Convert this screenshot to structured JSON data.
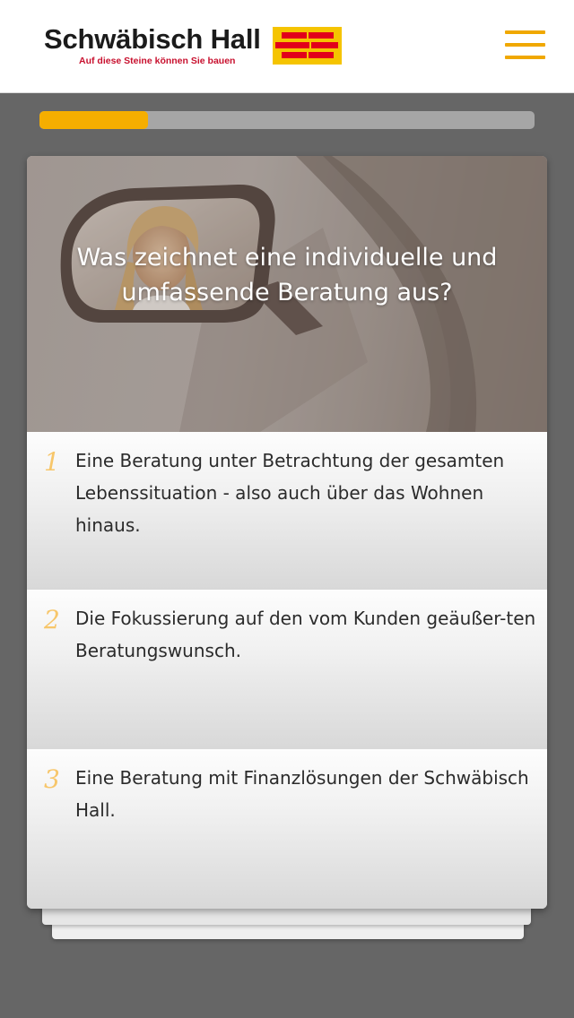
{
  "header": {
    "logo_name": "Schwäbisch Hall",
    "logo_tagline": "Auf diese Steine können Sie bauen",
    "logo_icon": "brick-logo-icon",
    "menu_icon": "hamburger-menu-icon",
    "brand_yellow": "#f5ae00",
    "brand_red": "#c8102e"
  },
  "progress": {
    "fraction": 0.22
  },
  "quiz": {
    "question": "Was zeichnet eine individuelle und umfassende Beratung aus?",
    "answers": [
      {
        "number": "1",
        "text": "Eine Beratung unter Betrachtung der gesamten Lebenssituation - also auch über das Wohnen hinaus."
      },
      {
        "number": "2",
        "text": "Die Fokussierung auf den vom Kunden geäußer-ten Beratungswunsch."
      },
      {
        "number": "3",
        "text": "Eine Beratung mit Finanzlösungen der Schwäbisch Hall."
      }
    ]
  }
}
